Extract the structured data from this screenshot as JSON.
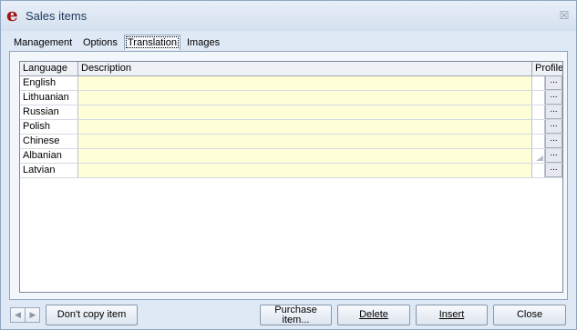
{
  "window": {
    "title": "Sales items",
    "app_logo": "e",
    "close_glyph": "☒"
  },
  "tabs": [
    {
      "label": "Management",
      "active": false
    },
    {
      "label": "Options",
      "active": false
    },
    {
      "label": "Translation",
      "active": true
    },
    {
      "label": "Images",
      "active": false
    }
  ],
  "grid": {
    "columns": [
      "Language",
      "Description",
      "Profile"
    ],
    "rows": [
      {
        "language": "English",
        "description": "",
        "button": "..."
      },
      {
        "language": "Lithuanian",
        "description": "",
        "button": "..."
      },
      {
        "language": "Russian",
        "description": "",
        "button": "..."
      },
      {
        "language": "Polish",
        "description": "",
        "button": "..."
      },
      {
        "language": "Chinese",
        "description": "",
        "button": "..."
      },
      {
        "language": "Albanian",
        "description": "",
        "button": "..."
      },
      {
        "language": "Latvian",
        "description": "",
        "button": "..."
      }
    ],
    "description_bg": "#ffffd7"
  },
  "footer": {
    "nav_prev_icon": "◀",
    "nav_next_icon": "▶",
    "dont_copy_label": "Don't copy item",
    "purchase_line1": "Purchase",
    "purchase_line2": "item...",
    "delete_label": "Delete",
    "insert_label": "Insert",
    "close_label": "Close"
  },
  "colors": {
    "accent": "#a31616",
    "frame": "#dfe9f5"
  }
}
